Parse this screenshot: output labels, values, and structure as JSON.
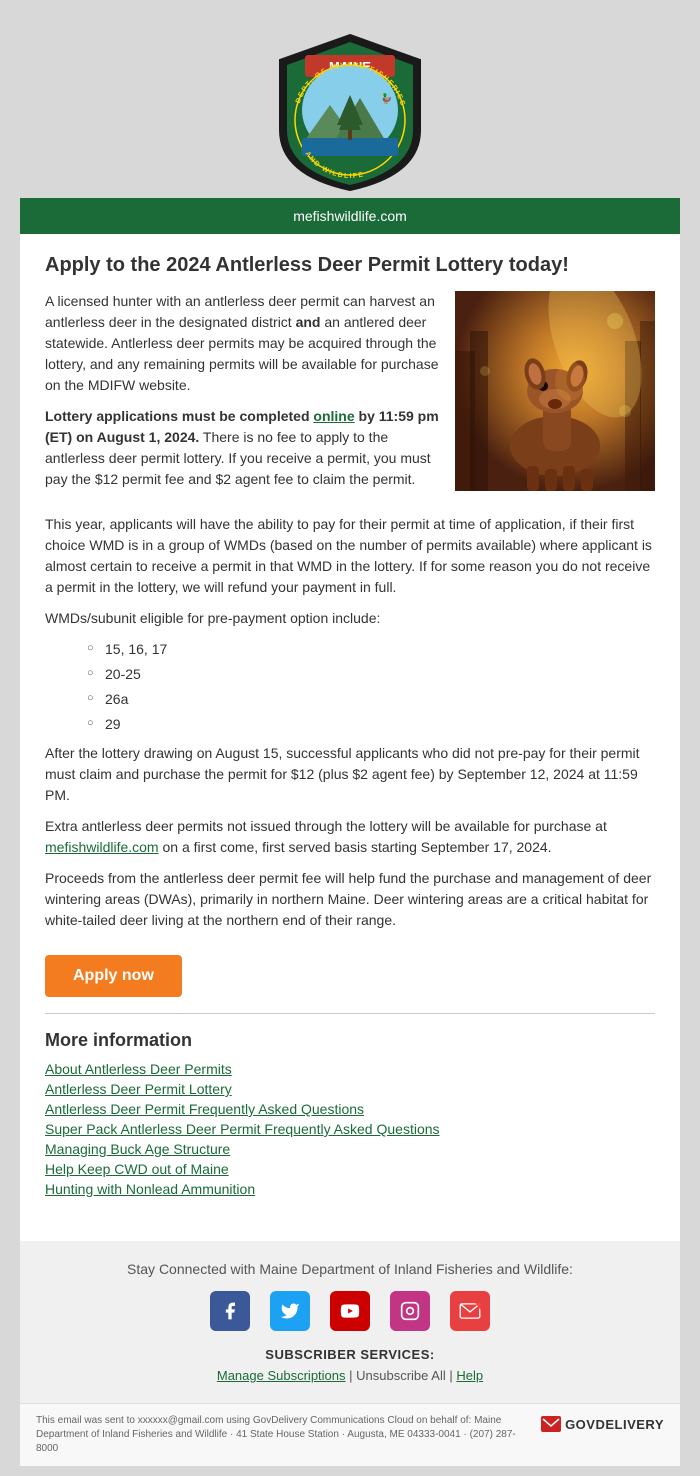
{
  "header": {
    "website": "mefishwildlife.com",
    "logo_text_top": "MAINE",
    "logo_text_arc": "DEPT. OF INLAND FISHERIES AND WILDLIFE"
  },
  "article": {
    "title": "Apply to the 2024 Antlerless Deer Permit Lottery today!",
    "paragraph1": "A licensed hunter with an antlerless deer permit can harvest an antlerless deer in the designated district ",
    "paragraph1_bold": "and",
    "paragraph1_cont": " an antlered deer statewide. Antlerless deer permits may be acquired through the lottery, and any remaining permits will be available for purchase on the MDIFW website.",
    "paragraph2_bold": "Lottery applications must be completed ",
    "paragraph2_link_text": "online",
    "paragraph2_cont": " by 11:59 pm (ET) on August 1, 2024.",
    "paragraph2_rest": " There is no fee to apply to the antlerless deer permit lottery. If you receive a permit, you must pay the $12 permit fee and $2 agent fee to claim the permit.",
    "paragraph3": "This year, applicants will have the ability to pay for their permit at time of application, if their first choice WMD is in a group of WMDs (based on the number of permits available) where applicant is almost certain to receive a permit in that WMD in the lottery. If for some reason you do not receive a permit in the lottery, we will refund your payment in full.",
    "paragraph4": "WMDs/subunit eligible for pre-payment option include:",
    "bullet_items": [
      "15, 16, 17",
      "20-25",
      "26a",
      "29"
    ],
    "paragraph5": "After the lottery drawing on August 15, successful applicants who did not pre-pay for their permit must claim and purchase the permit for $12 (plus $2 agent fee) by September 12, 2024 at 11:59 PM.",
    "paragraph6_text": "Extra antlerless deer permits not issued through the lottery will be available for purchase at ",
    "paragraph6_link": "mefishwildlife.com",
    "paragraph6_cont": " on a first come, first served basis starting September 17, 2024.",
    "paragraph7": "Proceeds from the antlerless deer permit fee will help fund the purchase and management of deer wintering areas (DWAs), primarily in northern Maine. Deer wintering areas are a critical habitat for white-tailed deer living at the northern end of their range.",
    "apply_button": "Apply now"
  },
  "more_info": {
    "title": "More information",
    "links": [
      "About Antlerless Deer Permits",
      "Antlerless Deer Permit Lottery",
      "Antlerless Deer Permit Frequently Asked Questions",
      "Super Pack Antlerless Deer Permit Frequently Asked Questions",
      "Managing Buck Age Structure",
      "Help Keep CWD out of Maine",
      "Hunting with Nonlead Ammunition"
    ]
  },
  "footer": {
    "stay_connected": "Stay Connected with Maine Department of Inland Fisheries and Wildlife:",
    "subscriber_services": "SUBSCRIBER SERVICES:",
    "manage_subscriptions": "Manage Subscriptions",
    "separator1": " | ",
    "unsubscribe_all": "Unsubscribe All",
    "separator2": " | ",
    "help": "Help",
    "fine_print": "This email was sent to xxxxxx@gmail.com using GovDelivery Communications Cloud on behalf of: Maine Department of Inland Fisheries and Wildlife · 41 State House Station · Augusta, ME 04333-0041 · (207) 287-8000",
    "govdelivery_label": "GOVDELIVERY"
  },
  "social_icons": [
    {
      "name": "facebook",
      "symbol": "f",
      "label": "Facebook"
    },
    {
      "name": "twitter",
      "symbol": "t",
      "label": "Twitter"
    },
    {
      "name": "youtube",
      "symbol": "▶",
      "label": "YouTube"
    },
    {
      "name": "instagram",
      "symbol": "📷",
      "label": "Instagram"
    },
    {
      "name": "email",
      "symbol": "✉",
      "label": "Email"
    }
  ]
}
